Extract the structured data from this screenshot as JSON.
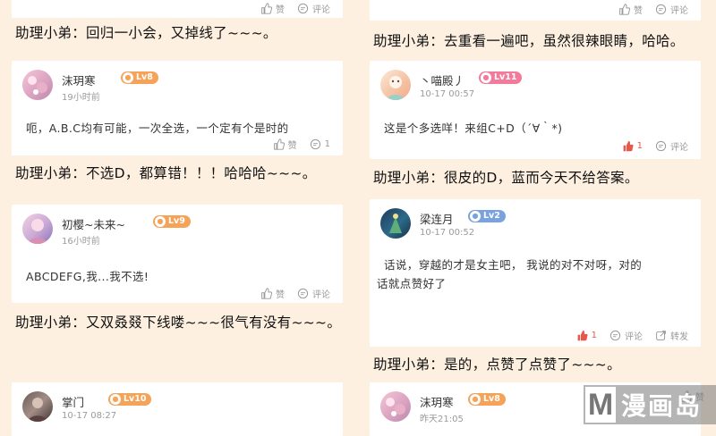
{
  "left": {
    "top_actions": {
      "like": "赞",
      "comment": "评论"
    },
    "caption1": "助理小弟：回归一小会，又掉线了~~~。",
    "card1": {
      "user": "沫玥寒",
      "level": "Lv8",
      "time": "19小时前",
      "text": "呃，A.B.C均有可能，一次全选，一个定有个是时的",
      "like": "赞",
      "comment_count": "1"
    },
    "caption2": "助理小弟：不选D，都算错！！！哈哈哈~~~。",
    "card2": {
      "user": "初樱~未来~",
      "level": "Lv9",
      "time": "16小时前",
      "text": "ABCDEFG,我...我不选!",
      "like": "赞",
      "comment": "评论"
    },
    "caption3": "助理小弟：又双叒叕下线喽~~~很气有没有~~~。",
    "card3": {
      "user": "掌门",
      "level": "Lv10",
      "time": "10-17 08:27"
    }
  },
  "right": {
    "top_actions": {
      "like": "赞",
      "comment": "评论"
    },
    "caption1": "助理小弟：去重看一遍吧，虽然很辣眼睛，哈哈。",
    "card1": {
      "user": "丶喵殿丿",
      "level": "Lv11",
      "time": "10-17 00:57",
      "text": "这是个多选咩！来组C+D（´∀｀*)",
      "like_count": "1",
      "comment": "评论"
    },
    "caption2": "助理小弟：很皮的D，蓝而今天不给答案。",
    "card2": {
      "user": "梁连月",
      "level": "Lv2",
      "time": "10-17 00:52",
      "text_line1": "话说，穿越的才是女主吧， 我说的对不对呀，对的",
      "text_line2": "话就点赞好了",
      "like_count": "1",
      "comment": "评论",
      "forward": "转发"
    },
    "caption3": "助理小弟：是的，点赞了点赞了~~~。",
    "card3": {
      "user": "沫玥寒",
      "level": "Lv8",
      "time": "昨天21:05",
      "like": "赞"
    }
  },
  "watermark": {
    "letter": "M",
    "text": "漫画岛"
  },
  "colors": {
    "background": "#fdf0e0",
    "level_orange": "#f6a35a",
    "level_blue": "#7aa2df",
    "level_pink": "#f27a9b",
    "liked": "#e5584a"
  }
}
